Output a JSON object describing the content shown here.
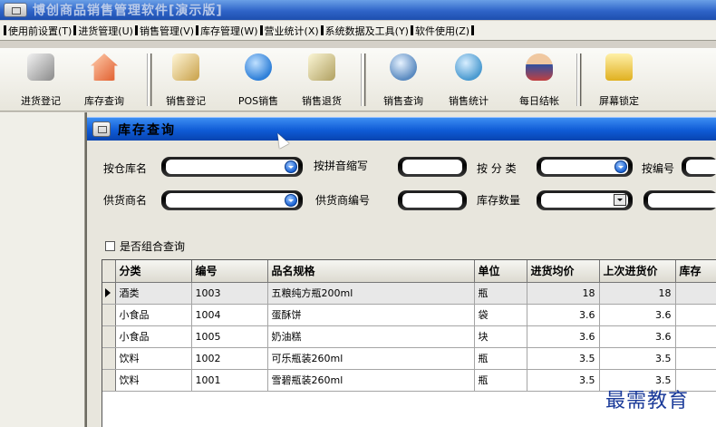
{
  "app": {
    "title": "博创商品销售管理软件[演示版]"
  },
  "menu": [
    {
      "label": "使用前设置(T)"
    },
    {
      "label": "进货管理(U)"
    },
    {
      "label": "销售管理(V)"
    },
    {
      "label": "库存管理(W)"
    },
    {
      "label": "营业统计(X)"
    },
    {
      "label": "系统数据及工具(Y)"
    },
    {
      "label": "软件使用(Z)"
    }
  ],
  "toolbar": [
    {
      "label": "进货登记",
      "icon": "pen-receipt-icon",
      "color": "#7a7a7a"
    },
    {
      "label": "库存查询",
      "icon": "house-icon",
      "color": "#e05a2a"
    },
    {
      "label": "销售登记",
      "icon": "notepad-pencil-icon",
      "color": "#c8a048"
    },
    {
      "label": "POS销售",
      "icon": "info-bubble-icon",
      "color": "#2e7fd8"
    },
    {
      "label": "销售退货",
      "icon": "checklist-icon",
      "color": "#b0a060"
    },
    {
      "label": "销售查询",
      "icon": "magnifier-icon",
      "color": "#5a8ac0"
    },
    {
      "label": "销售统计",
      "icon": "globe-chart-icon",
      "color": "#4a9ad0"
    },
    {
      "label": "每日结帐",
      "icon": "person-icon",
      "color": "#c04040"
    },
    {
      "label": "屏幕锁定",
      "icon": "padlock-icon",
      "color": "#e0b020"
    }
  ],
  "window": {
    "title": "库存查询"
  },
  "filters": {
    "warehouse_label": "按仓库名",
    "pinyin_label": "按拼音缩写",
    "category_label": "按 分 类",
    "code_label": "按编号",
    "supplier_label": "供货商名",
    "supplier_code_label": "供货商编号",
    "stock_qty_label": "库存数量",
    "combo_label": "是否组合查询"
  },
  "table": {
    "headers": [
      "分类",
      "编号",
      "品名规格",
      "单位",
      "进货均价",
      "上次进货价",
      "库存"
    ],
    "rows": [
      [
        "酒类",
        "1003",
        "五粮纯方瓶200ml",
        "瓶",
        "18",
        "18"
      ],
      [
        "小食品",
        "1004",
        "蛋酥饼",
        "袋",
        "3.6",
        "3.6"
      ],
      [
        "小食品",
        "1005",
        "奶油糕",
        "块",
        "3.6",
        "3.6"
      ],
      [
        "饮料",
        "1002",
        "可乐瓶装260ml",
        "瓶",
        "3.5",
        "3.5"
      ],
      [
        "饮料",
        "1001",
        "雪碧瓶装260ml",
        "瓶",
        "3.5",
        "3.5"
      ]
    ]
  },
  "watermark": "最需教育"
}
